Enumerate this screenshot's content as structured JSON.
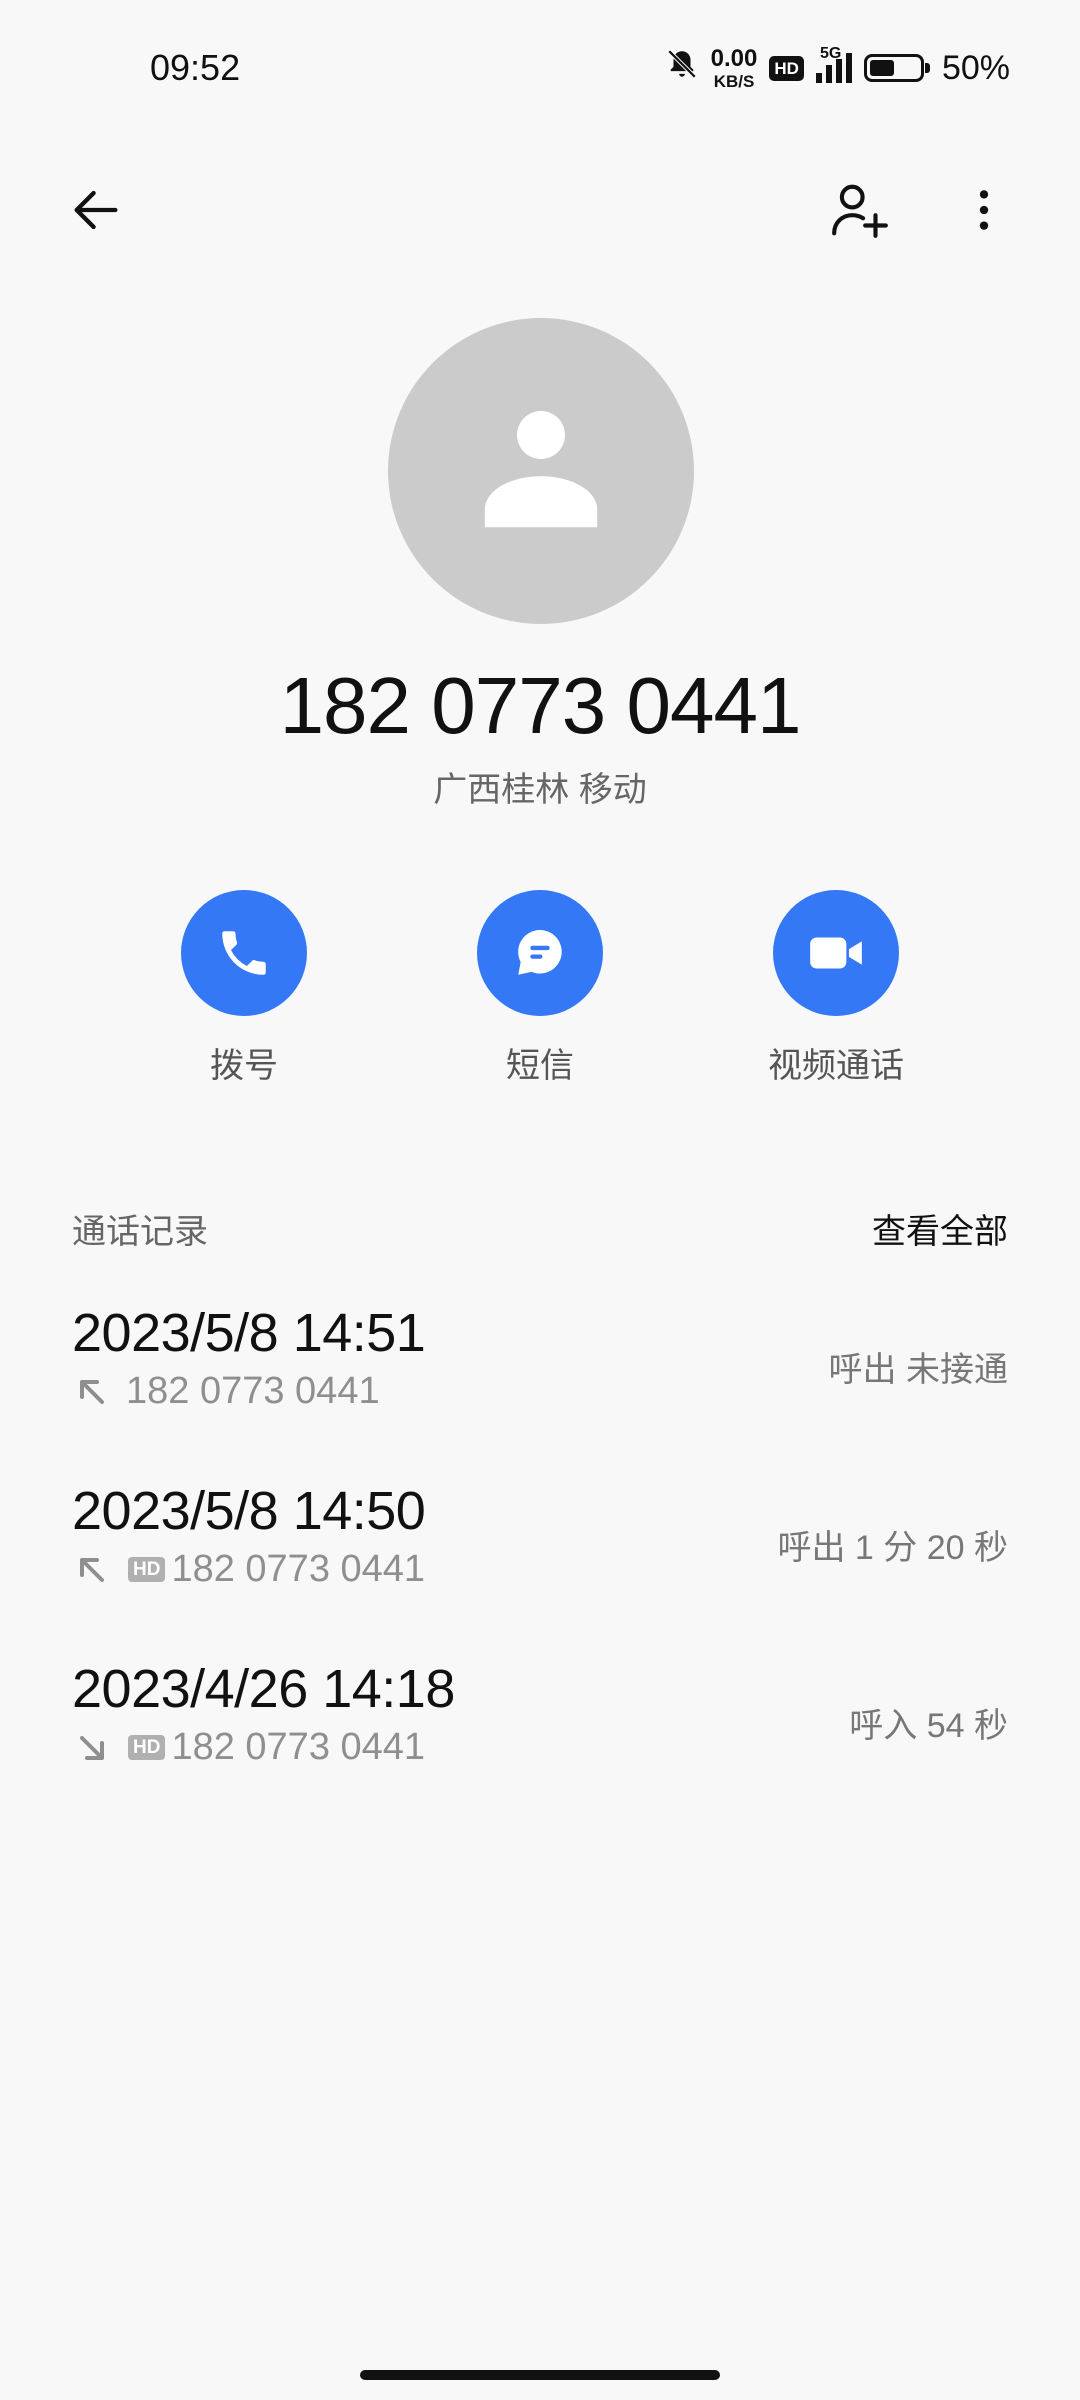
{
  "status_bar": {
    "time": "09:52",
    "net_speed_value": "0.00",
    "net_speed_unit": "KB/S",
    "hd_label": "HD",
    "network_label": "5G",
    "battery_percent": "50%",
    "battery_level": 0.5
  },
  "contact": {
    "number": "182 0773 0441",
    "location": "广西桂林 移动"
  },
  "actions": [
    {
      "label": "拨号",
      "icon": "phone-icon"
    },
    {
      "label": "短信",
      "icon": "message-icon"
    },
    {
      "label": "视频通话",
      "icon": "video-camera-icon"
    }
  ],
  "call_log": {
    "title": "通话记录",
    "view_all": "查看全部",
    "entries": [
      {
        "datetime": "2023/5/8 14:51",
        "number": "182 0773 0441",
        "hd": "",
        "direction": "outgoing",
        "status": "呼出 未接通"
      },
      {
        "datetime": "2023/5/8 14:50",
        "number": "182 0773 0441",
        "hd": "HD",
        "direction": "outgoing",
        "status": "呼出 1 分 20 秒"
      },
      {
        "datetime": "2023/4/26 14:18",
        "number": "182 0773 0441",
        "hd": "HD",
        "direction": "incoming",
        "status": "呼入 54 秒"
      }
    ]
  },
  "colors": {
    "accent": "#3478f6",
    "avatar_bg": "#cbcbcb",
    "background": "#f8f8f8"
  }
}
